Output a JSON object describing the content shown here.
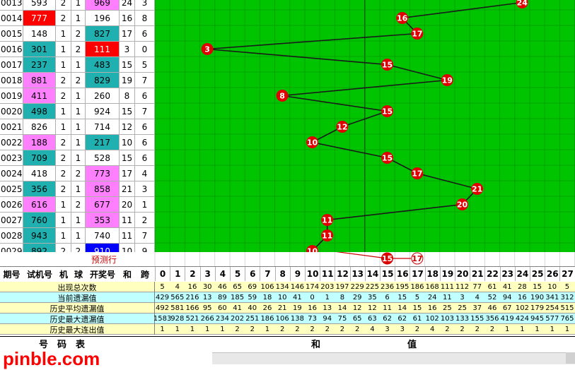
{
  "left_table": {
    "rows": [
      {
        "issue": "0013",
        "test": "593",
        "m": "2",
        "q": "1",
        "draw": "969",
        "sum": "24",
        "span": "3",
        "testColor": "#ffffff",
        "drawColor": "#ff80ff"
      },
      {
        "issue": "0014",
        "test": "777",
        "m": "2",
        "q": "1",
        "draw": "196",
        "sum": "16",
        "span": "8",
        "testColor": "#ff0000",
        "drawColor": "#ffffff"
      },
      {
        "issue": "0015",
        "test": "148",
        "m": "1",
        "q": "2",
        "draw": "827",
        "sum": "17",
        "span": "6",
        "testColor": "#ffffff",
        "drawColor": "#20b0b0"
      },
      {
        "issue": "0016",
        "test": "301",
        "m": "1",
        "q": "2",
        "draw": "111",
        "sum": "3",
        "span": "0",
        "testColor": "#20b0b0",
        "drawColor": "#ff0000"
      },
      {
        "issue": "0017",
        "test": "237",
        "m": "1",
        "q": "1",
        "draw": "483",
        "sum": "15",
        "span": "5",
        "testColor": "#20b0b0",
        "drawColor": "#20b0b0"
      },
      {
        "issue": "0018",
        "test": "881",
        "m": "2",
        "q": "2",
        "draw": "829",
        "sum": "19",
        "span": "7",
        "testColor": "#ff80ff",
        "drawColor": "#20b0b0"
      },
      {
        "issue": "0019",
        "test": "411",
        "m": "2",
        "q": "1",
        "draw": "260",
        "sum": "8",
        "span": "6",
        "testColor": "#ff80ff",
        "drawColor": "#ffffff"
      },
      {
        "issue": "0020",
        "test": "498",
        "m": "1",
        "q": "1",
        "draw": "924",
        "sum": "15",
        "span": "7",
        "testColor": "#20b0b0",
        "drawColor": "#ffffff"
      },
      {
        "issue": "0021",
        "test": "826",
        "m": "1",
        "q": "1",
        "draw": "714",
        "sum": "12",
        "span": "6",
        "testColor": "#ffffff",
        "drawColor": "#ffffff"
      },
      {
        "issue": "0022",
        "test": "188",
        "m": "2",
        "q": "1",
        "draw": "217",
        "sum": "10",
        "span": "6",
        "testColor": "#ff80ff",
        "drawColor": "#20b0b0"
      },
      {
        "issue": "0023",
        "test": "709",
        "m": "2",
        "q": "1",
        "draw": "528",
        "sum": "15",
        "span": "6",
        "testColor": "#20b0b0",
        "drawColor": "#ffffff"
      },
      {
        "issue": "0024",
        "test": "418",
        "m": "2",
        "q": "2",
        "draw": "773",
        "sum": "17",
        "span": "4",
        "testColor": "#ffffff",
        "drawColor": "#ff80ff"
      },
      {
        "issue": "0025",
        "test": "356",
        "m": "2",
        "q": "1",
        "draw": "858",
        "sum": "21",
        "span": "3",
        "testColor": "#20b0b0",
        "drawColor": "#ff80ff"
      },
      {
        "issue": "0026",
        "test": "616",
        "m": "1",
        "q": "2",
        "draw": "677",
        "sum": "20",
        "span": "1",
        "testColor": "#ff80ff",
        "drawColor": "#ff80ff"
      },
      {
        "issue": "0027",
        "test": "760",
        "m": "1",
        "q": "1",
        "draw": "353",
        "sum": "11",
        "span": "2",
        "testColor": "#20b0b0",
        "drawColor": "#ff80ff"
      },
      {
        "issue": "0028",
        "test": "943",
        "m": "1",
        "q": "1",
        "draw": "740",
        "sum": "11",
        "span": "7",
        "testColor": "#20b0b0",
        "drawColor": "#ffffff"
      },
      {
        "issue": "0029",
        "test": "892",
        "m": "2",
        "q": "2",
        "draw": "910",
        "sum": "10",
        "span": "9",
        "testColor": "#20b0b0",
        "drawColor": "#0000ff"
      }
    ],
    "predict_label": "预测行"
  },
  "header": {
    "issue": "期号",
    "test": "试机号",
    "m": "机",
    "q": "球",
    "draw": "开奖号",
    "sum": "和",
    "span": "跨"
  },
  "chart_data": {
    "type": "line",
    "x_categories": [
      "0",
      "1",
      "2",
      "3",
      "4",
      "5",
      "6",
      "7",
      "8",
      "9",
      "10",
      "11",
      "12",
      "13",
      "14",
      "15",
      "16",
      "17",
      "18",
      "19",
      "20",
      "21",
      "22",
      "23",
      "24",
      "25",
      "26",
      "27"
    ],
    "periods": [
      "0013",
      "0014",
      "0015",
      "0016",
      "0017",
      "0018",
      "0019",
      "0020",
      "0021",
      "0022",
      "0023",
      "0024",
      "0025",
      "0026",
      "0027",
      "0028",
      "0029"
    ],
    "sum_values": [
      24,
      16,
      17,
      3,
      15,
      19,
      8,
      15,
      12,
      10,
      15,
      17,
      21,
      20,
      11,
      11,
      10
    ],
    "predicted": [
      15,
      17
    ],
    "colors": {
      "grid_bg": "#00c400",
      "ball": "#e00000",
      "line": "#1a1a1a",
      "predict_ball": "#ffffff"
    }
  },
  "stats": {
    "rows": [
      {
        "label": "出现总次数",
        "bg": "#ffffc0",
        "values": [
          "5",
          "4",
          "16",
          "30",
          "46",
          "65",
          "69",
          "106",
          "134",
          "146",
          "174",
          "203",
          "197",
          "229",
          "225",
          "236",
          "195",
          "186",
          "168",
          "111",
          "112",
          "77",
          "61",
          "41",
          "28",
          "15",
          "10",
          "5"
        ]
      },
      {
        "label": "当前遗漏值",
        "bg": "#c0ffff",
        "values": [
          "429",
          "565",
          "216",
          "13",
          "89",
          "185",
          "59",
          "18",
          "10",
          "41",
          "0",
          "1",
          "8",
          "29",
          "35",
          "6",
          "15",
          "5",
          "24",
          "11",
          "3",
          "4",
          "52",
          "94",
          "16",
          "190",
          "341",
          "312"
        ]
      },
      {
        "label": "历史平均遗漏值",
        "bg": "#ffffc0",
        "values": [
          "492",
          "581",
          "166",
          "95",
          "60",
          "41",
          "40",
          "26",
          "21",
          "19",
          "16",
          "13",
          "14",
          "12",
          "12",
          "11",
          "14",
          "15",
          "16",
          "25",
          "25",
          "37",
          "46",
          "67",
          "102",
          "179",
          "254",
          "515"
        ]
      },
      {
        "label": "历史最大遗漏值",
        "bg": "#c0ffff",
        "values": [
          "1583",
          "928",
          "521",
          "266",
          "234",
          "202",
          "251",
          "186",
          "106",
          "138",
          "73",
          "94",
          "75",
          "65",
          "63",
          "62",
          "62",
          "61",
          "102",
          "103",
          "133",
          "155",
          "356",
          "419",
          "424",
          "945",
          "577",
          "765"
        ]
      },
      {
        "label": "历史最大连出值",
        "bg": "#ffffc0",
        "values": [
          "1",
          "1",
          "1",
          "1",
          "1",
          "2",
          "2",
          "1",
          "2",
          "2",
          "2",
          "2",
          "2",
          "2",
          "4",
          "3",
          "3",
          "2",
          "4",
          "2",
          "2",
          "2",
          "2",
          "1",
          "1",
          "1",
          "1",
          "1"
        ]
      }
    ]
  },
  "bottom": {
    "left": "号　码　表",
    "mid": "和",
    "right": "值"
  },
  "watermark": "pinble.com"
}
